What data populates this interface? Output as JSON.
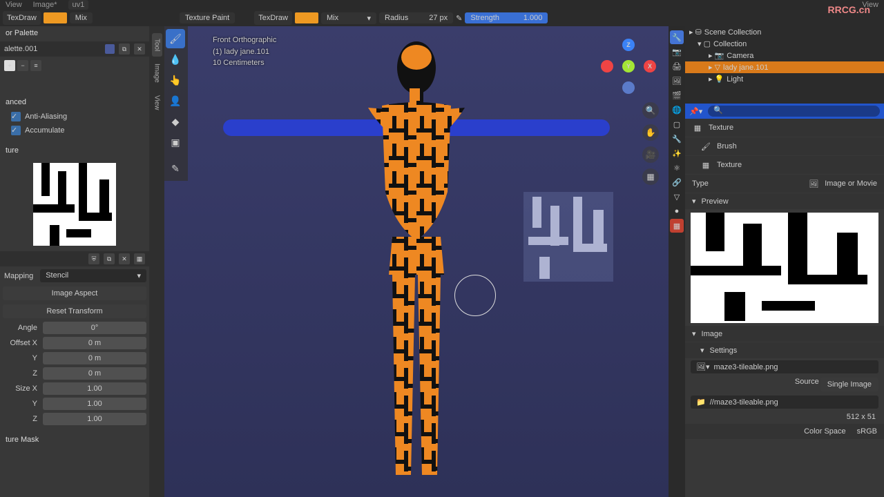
{
  "topbar": {
    "view1": "View",
    "image": "Image*",
    "uv": "uv1",
    "view2": "View"
  },
  "header": {
    "tex_label": "TexDraw",
    "blend": "Mix",
    "mode": "Texture Paint",
    "radius_label": "Radius",
    "radius_val": "27 px",
    "strength_label": "Strength",
    "strength_val": "1.000"
  },
  "left": {
    "palette_header": "or Palette",
    "palette_name": "alette.001",
    "advanced": "anced",
    "aa": "Anti-Aliasing",
    "accum": "Accumulate",
    "texture_header": "ture",
    "mapping_label": "Mapping",
    "mapping_mode": "Stencil",
    "img_aspect": "Image Aspect",
    "reset": "Reset Transform",
    "angle": "Angle",
    "angle_v": "0°",
    "offx": "Offset X",
    "offx_v": "0 m",
    "y": "Y",
    "y_v": "0 m",
    "z": "Z",
    "z_v": "0 m",
    "sizex": "Size X",
    "sizex_v": "1.00",
    "sy_v": "1.00",
    "sz_v": "1.00",
    "mask_header": "ture Mask"
  },
  "viewport": {
    "projection": "Front Orthographic",
    "objline": "(1) lady jane.101",
    "scale": "10 Centimeters",
    "tabs": {
      "tool": "Tool",
      "image": "Image",
      "view": "View"
    }
  },
  "outliner": {
    "scene": "Scene Collection",
    "coll": "Collection",
    "camera": "Camera",
    "obj": "lady jane.101",
    "light": "Light"
  },
  "props": {
    "texture": "Texture",
    "brush": "Brush",
    "texture2": "Texture",
    "type": "Type",
    "type_mode": "Image or Movie",
    "preview": "Preview",
    "image": "Image",
    "settings": "Settings",
    "img_name": "maze3-tileable.png",
    "source": "Source",
    "single": "Single Image",
    "path": "//maze3-tileable.png",
    "dim": "512 x 51",
    "colorspace": "Color Space",
    "srgb": "sRGB"
  },
  "watermark": "RRCG.cn"
}
